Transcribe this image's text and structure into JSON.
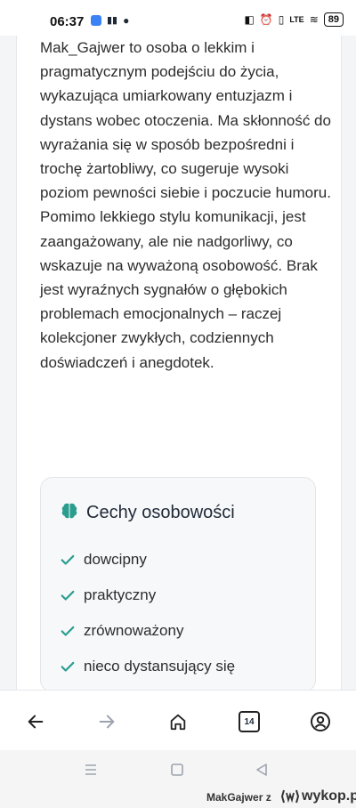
{
  "status_bar": {
    "time": "06:37",
    "network_label": "LTE",
    "battery": "89"
  },
  "profile": {
    "summary": "Mak_Gajwer to osoba o lekkim i pragmatycznym podejściu do życia, wykazująca umiarkowany entuzjazm i dystans wobec otoczenia. Ma skłonność do wyrażania się w sposób bezpośredni i trochę żartobliwy, co sugeruje wysoki poziom pewności siebie i poczucie humoru. Pomimo lekkiego stylu komunikacji, jest zaangażowany, ale nie nadgorliwy, co wskazuje na wyważoną osobowość. Brak jest wyraźnych sygnałów o głębokich problemach emocjonalnych – raczej kolekcjoner zwykłych, codziennych doświadczeń i anegdotek.",
    "traits_title": "Cechy osobowości",
    "traits_icon": "brain-icon",
    "traits": [
      "dowcipny",
      "praktyczny",
      "zrównoważony",
      "nieco dystansujący się"
    ]
  },
  "toolbar": {
    "tab_count": "14",
    "icons": [
      "back-arrow-icon",
      "forward-arrow-icon",
      "home-icon",
      "tabs-icon",
      "account-icon"
    ]
  },
  "navbar": {
    "icons": [
      "recents-icon",
      "home-square-icon",
      "back-triangle-icon"
    ]
  },
  "watermark": {
    "user": "MakGajwer",
    "separator": "z",
    "site": "wykop.pl"
  },
  "colors": {
    "accent": "#2a9d8f",
    "text": "#2d2d2d",
    "background": "#f4f5f7"
  }
}
